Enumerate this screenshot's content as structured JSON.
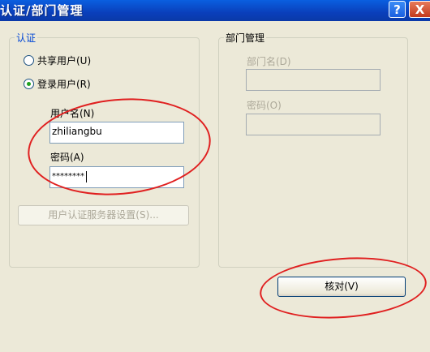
{
  "window": {
    "title": "认证/部门管理",
    "help_label": "?",
    "close_label": "X"
  },
  "auth": {
    "legend": "认证",
    "shared_user_label": "共享用户(U)",
    "login_user_label": "登录用户(R)",
    "selected": "login_user",
    "username_label": "用户名(N)",
    "username_value": "zhiliangbu",
    "password_label": "密码(A)",
    "password_value": "********",
    "server_settings_label": "用户认证服务器设置(S)..."
  },
  "dept": {
    "legend": "部门管理",
    "dept_name_label": "部门名(D)",
    "dept_name_value": "",
    "password_label": "密码(O)",
    "password_value": ""
  },
  "verify_label": "核对(V)",
  "colors": {
    "accent": "#0046d5",
    "highlight": "#e02020",
    "title_bar": "#0a4fd0"
  }
}
